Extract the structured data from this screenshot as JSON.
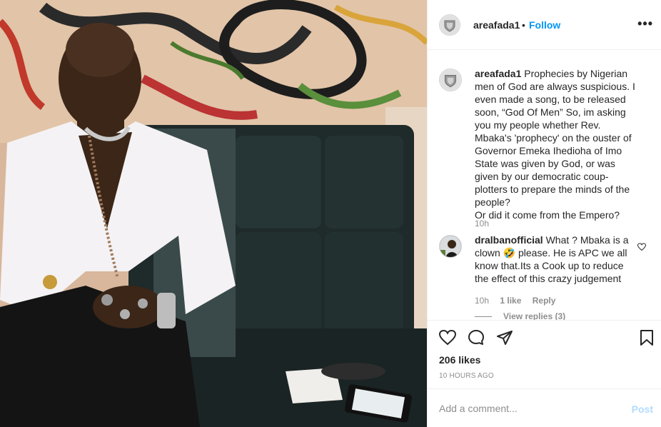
{
  "post": {
    "username": "areafada1",
    "separator": "•",
    "follow_label": "Follow",
    "more_icon": "more-horizontal-icon",
    "more_text": "•••"
  },
  "caption": {
    "username": "areafada1",
    "text": "Prophecies by Nigerian men of God are always suspicious. I even made a song, to be released soon, “God Of Men” So, im asking you my people whether Rev. Mbaka's 'prophecy' on the ouster of Governor Emeka Ihedioha of Imo State was given by God, or was given by our democratic coup-plotters to prepare the minds of the people?\nOr did it come from the Empero?",
    "time": "10h"
  },
  "comments": [
    {
      "username": "dralbanofficial",
      "text": "What ? Mbaka is a clown 🤣 please. He is APC we all know that.Its a Cook up to reduce the effect of this crazy judgement",
      "time": "10h",
      "likes": "1 like",
      "reply_label": "Reply",
      "view_replies": "View replies (3)"
    }
  ],
  "actions": {
    "like_icon": "heart-icon",
    "comment_icon": "comment-bubble-icon",
    "share_icon": "paper-plane-icon",
    "save_icon": "bookmark-icon"
  },
  "likes_count": "206 likes",
  "post_time": "10 HOURS AGO",
  "add_comment": {
    "placeholder": "Add a comment...",
    "post_label": "Post"
  },
  "colors": {
    "accent": "#0095f6",
    "post_disabled": "#b3dbff",
    "secondary_text": "#8e8e8e",
    "border": "#efefef"
  }
}
